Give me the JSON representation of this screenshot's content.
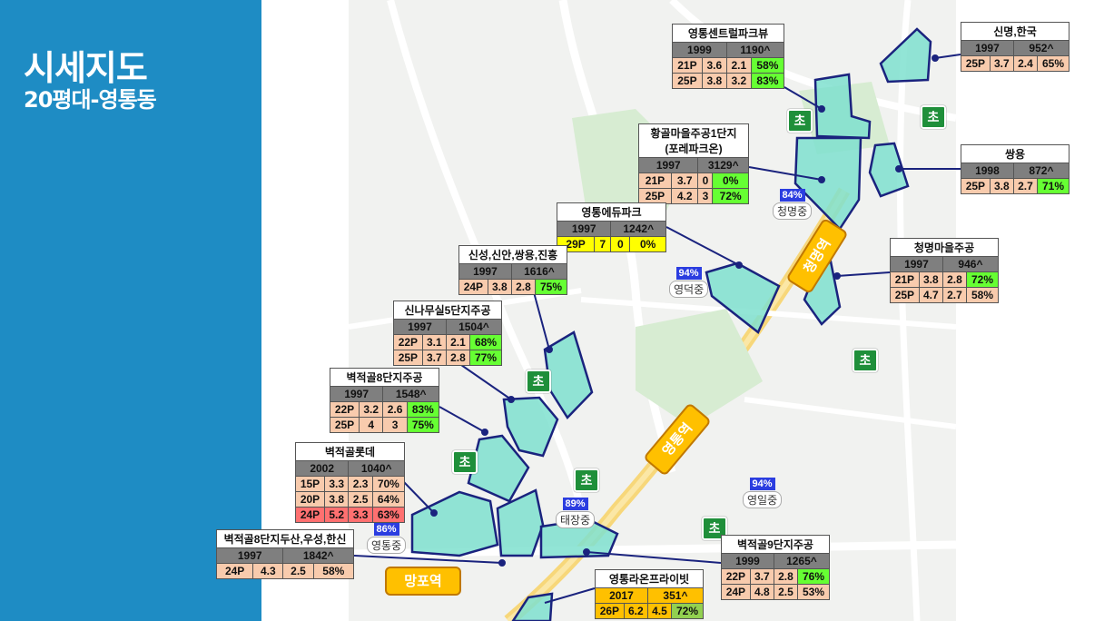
{
  "header": {
    "title": "시세지도",
    "subtitle": "20평대-영통동"
  },
  "colors": {
    "sidebar": "#1e8cc4",
    "complex_fill": "#7fe0cf",
    "complex_border": "#1a237e",
    "station": "#ffc000",
    "school": "#1f8f3a",
    "middle_school": "#2b3de0"
  },
  "stations": [
    {
      "name": "청명역"
    },
    {
      "name": "영통역"
    },
    {
      "name": "망포역"
    }
  ],
  "schools": {
    "elementary_label": "초"
  },
  "middle_schools": [
    {
      "pct": "84%",
      "name": "청명중"
    },
    {
      "pct": "94%",
      "name": "영덕중"
    },
    {
      "pct": "94%",
      "name": "영일중"
    },
    {
      "pct": "89%",
      "name": "태장중"
    },
    {
      "pct": "86%",
      "name": "영통중"
    }
  ],
  "complexes": [
    {
      "name": "영통센트럴파크뷰",
      "year": "1999",
      "units": "1190^",
      "rows": [
        [
          "21P",
          "3.6",
          "2.1",
          "58%"
        ],
        [
          "25P",
          "3.8",
          "3.2",
          "83%"
        ]
      ]
    },
    {
      "name": "신명,한국",
      "year": "1997",
      "units": "952^",
      "rows": [
        [
          "25P",
          "3.7",
          "2.4",
          "65%"
        ]
      ]
    },
    {
      "name": "황골마을주공1단지",
      "name2": "(포레파크온)",
      "year": "1997",
      "units": "3129^",
      "rows": [
        [
          "21P",
          "3.7",
          "0",
          "0%"
        ],
        [
          "25P",
          "4.2",
          "3",
          "72%"
        ]
      ]
    },
    {
      "name": "쌍용",
      "year": "1998",
      "units": "872^",
      "rows": [
        [
          "25P",
          "3.8",
          "2.7",
          "71%"
        ]
      ]
    },
    {
      "name": "영통에듀파크",
      "year": "1997",
      "units": "1242^",
      "rows": [
        [
          "29P",
          "7",
          "0",
          "0%"
        ]
      ]
    },
    {
      "name": "신성,신안,쌍용,진흥",
      "year": "1997",
      "units": "1616^",
      "rows": [
        [
          "24P",
          "3.8",
          "2.8",
          "75%"
        ]
      ]
    },
    {
      "name": "청명마을주공",
      "year": "1997",
      "units": "946^",
      "rows": [
        [
          "21P",
          "3.8",
          "2.8",
          "72%"
        ],
        [
          "25P",
          "4.7",
          "2.7",
          "58%"
        ]
      ]
    },
    {
      "name": "신나무실5단지주공",
      "year": "1997",
      "units": "1504^",
      "rows": [
        [
          "22P",
          "3.1",
          "2.1",
          "68%"
        ],
        [
          "25P",
          "3.7",
          "2.8",
          "77%"
        ]
      ]
    },
    {
      "name": "벽적골8단지주공",
      "year": "1997",
      "units": "1548^",
      "rows": [
        [
          "22P",
          "3.2",
          "2.6",
          "83%"
        ],
        [
          "25P",
          "4",
          "3",
          "75%"
        ]
      ]
    },
    {
      "name": "벽적골롯데",
      "year": "2002",
      "units": "1040^",
      "rows": [
        [
          "15P",
          "3.3",
          "2.3",
          "70%"
        ],
        [
          "20P",
          "3.8",
          "2.5",
          "64%"
        ],
        [
          "24P",
          "5.2",
          "3.3",
          "63%"
        ]
      ]
    },
    {
      "name": "벽적골8단지두산,우성,한신",
      "year": "1997",
      "units": "1842^",
      "rows": [
        [
          "24P",
          "4.3",
          "2.5",
          "58%"
        ]
      ]
    },
    {
      "name": "벽적골9단지주공",
      "year": "1999",
      "units": "1265^",
      "rows": [
        [
          "22P",
          "3.7",
          "2.8",
          "76%"
        ],
        [
          "24P",
          "4.8",
          "2.5",
          "53%"
        ]
      ]
    },
    {
      "name": "영통라온프라이빗",
      "year": "2017",
      "units": "351^",
      "rows": [
        [
          "26P",
          "6.2",
          "4.5",
          "72%"
        ]
      ]
    }
  ]
}
